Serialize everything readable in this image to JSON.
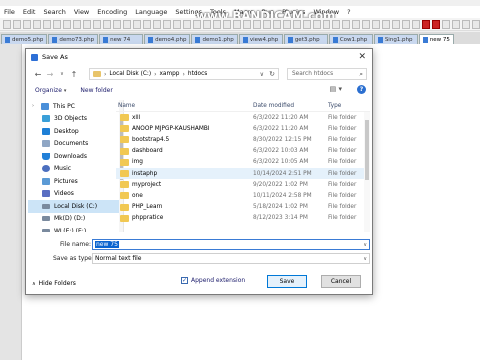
{
  "app": {
    "menu": [
      "File",
      "Edit",
      "Search",
      "View",
      "Encoding",
      "Language",
      "Settings",
      "Tools",
      "Macro",
      "Run",
      "Plugins",
      "Window",
      "?"
    ],
    "watermark": "www.BANDICAM.com",
    "tabs": [
      "demo5.php",
      "demo73.php",
      "new 74",
      "demo4.php",
      "demo1.php",
      "view4.php",
      "get3.php",
      "Cow1.php",
      "Sing1.php",
      "new 75"
    ]
  },
  "dialog": {
    "title": "Save As",
    "close": "✕",
    "address": {
      "breadcrumb": [
        "Local Disk (C:)",
        "xampp",
        "htdocs"
      ],
      "search_placeholder": "Search htdocs"
    },
    "commands": {
      "organize": "Organize",
      "new_folder": "New folder"
    },
    "nav": [
      {
        "label": "This PC",
        "icon": "pc-icon",
        "level": 0
      },
      {
        "label": "3D Objects",
        "icon": "3d-objects-icon",
        "level": 1
      },
      {
        "label": "Desktop",
        "icon": "desktop-icon",
        "level": 1
      },
      {
        "label": "Documents",
        "icon": "documents-icon",
        "level": 1
      },
      {
        "label": "Downloads",
        "icon": "downloads-icon",
        "level": 1
      },
      {
        "label": "Music",
        "icon": "music-icon",
        "level": 1
      },
      {
        "label": "Pictures",
        "icon": "pictures-icon",
        "level": 1
      },
      {
        "label": "Videos",
        "icon": "videos-icon",
        "level": 1
      },
      {
        "label": "Local Disk (C:)",
        "icon": "drive-icon",
        "level": 1,
        "selected": true
      },
      {
        "label": "Mk(D) (D:)",
        "icon": "drive-icon",
        "level": 1
      },
      {
        "label": "WL(E:) (E:)",
        "icon": "drive-icon",
        "level": 1
      }
    ],
    "columns": {
      "name": "Name",
      "date": "Date modified",
      "type": "Type"
    },
    "files": [
      {
        "name": "xlll",
        "date": "6/3/2022 11:20 AM",
        "type": "File folder"
      },
      {
        "name": "ANOOP MJPGP-KAUSHAMBI",
        "date": "6/3/2022 11:20 AM",
        "type": "File folder"
      },
      {
        "name": "bootstrap4.5",
        "date": "8/30/2022 12:15 PM",
        "type": "File folder"
      },
      {
        "name": "dashboard",
        "date": "6/3/2022 10:03 AM",
        "type": "File folder"
      },
      {
        "name": "img",
        "date": "6/3/2022 10:05 AM",
        "type": "File folder"
      },
      {
        "name": "instaphp",
        "date": "10/14/2024 2:51 PM",
        "type": "File folder",
        "highlight": true
      },
      {
        "name": "myproject",
        "date": "9/20/2022 1:02 PM",
        "type": "File folder"
      },
      {
        "name": "one",
        "date": "10/11/2024 2:58 PM",
        "type": "File folder"
      },
      {
        "name": "PHP_Learn",
        "date": "5/18/2024 1:02 PM",
        "type": "File folder"
      },
      {
        "name": "phppratice",
        "date": "8/12/2023 3:14 PM",
        "type": "File folder"
      }
    ],
    "file_name_label": "File name:",
    "file_name_value": "new 75",
    "save_type_label": "Save as type:",
    "save_type_value": "Normal text file",
    "hide_folders": "Hide Folders",
    "append_extension": "Append extension",
    "append_checked": true,
    "save_button": "Save",
    "cancel_button": "Cancel"
  }
}
